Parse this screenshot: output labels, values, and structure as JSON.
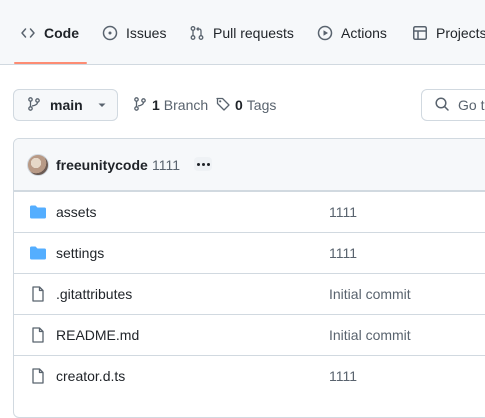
{
  "tabs": [
    {
      "label": "Code",
      "icon": "code-icon",
      "active": true
    },
    {
      "label": "Issues",
      "icon": "issue-icon"
    },
    {
      "label": "Pull requests",
      "icon": "pull-request-icon"
    },
    {
      "label": "Actions",
      "icon": "play-icon"
    },
    {
      "label": "Projects",
      "icon": "table-icon"
    }
  ],
  "toolbar": {
    "branch": "main",
    "branch_count": "1",
    "branch_label": "Branch",
    "tag_count": "0",
    "tag_label": "Tags",
    "goto_placeholder": "Go t"
  },
  "latest_commit": {
    "author": "freeunitycode",
    "message": "1111"
  },
  "files": [
    {
      "name": "assets",
      "type": "folder",
      "message": "1111"
    },
    {
      "name": "settings",
      "type": "folder",
      "message": "1111"
    },
    {
      "name": ".gitattributes",
      "type": "file",
      "message": "Initial commit"
    },
    {
      "name": "README.md",
      "type": "file",
      "message": "Initial commit"
    },
    {
      "name": "creator.d.ts",
      "type": "file",
      "message": "1111"
    }
  ],
  "colors": {
    "accent_underline": "#fd8c73",
    "folder": "#54aeff",
    "muted_text": "#59636e"
  }
}
